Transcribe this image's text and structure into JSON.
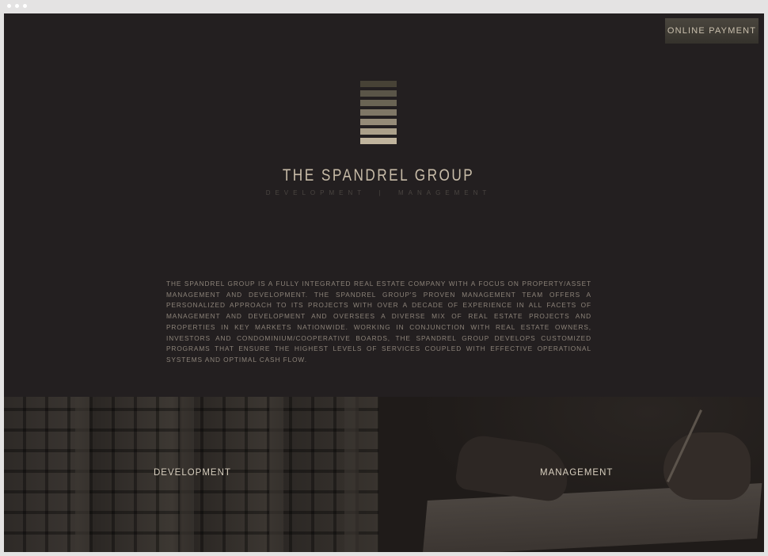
{
  "header": {
    "payment_button": "ONLINE PAYMENT"
  },
  "brand": {
    "name": "THE SPANDREL GROUP",
    "tagline": "DEVELOPMENT  |  MANAGEMENT",
    "logo_bar_colors": [
      "#474236",
      "#5a5548",
      "#6a6454",
      "#7f7766",
      "#958b78",
      "#aba08a",
      "#c0b49d"
    ]
  },
  "about": {
    "text": "THE SPANDREL GROUP IS A FULLY INTEGRATED REAL ESTATE COMPANY WITH A FOCUS ON PROPERTY/ASSET MANAGEMENT AND DEVELOPMENT. THE SPANDREL GROUP'S PROVEN MANAGEMENT TEAM OFFERS A PERSONALIZED APPROACH TO ITS PROJECTS WITH OVER A DECADE OF EXPERIENCE IN ALL FACETS OF MANAGEMENT AND DEVELOPMENT AND OVERSEES A DIVERSE MIX OF REAL ESTATE PROJECTS AND PROPERTIES IN KEY MARKETS NATIONWIDE. WORKING IN CONJUNCTION WITH REAL ESTATE OWNERS, INVESTORS AND CONDOMINIUM/COOPERATIVE BOARDS, THE SPANDREL GROUP DEVELOPS CUSTOMIZED PROGRAMS THAT ENSURE THE HIGHEST LEVELS OF SERVICES COUPLED WITH EFFECTIVE OPERATIONAL SYSTEMS AND OPTIMAL CASH FLOW."
  },
  "panels": {
    "development": "DEVELOPMENT",
    "management": "MANAGEMENT"
  },
  "colors": {
    "background": "#231f20",
    "accent": "#c8bca8"
  }
}
